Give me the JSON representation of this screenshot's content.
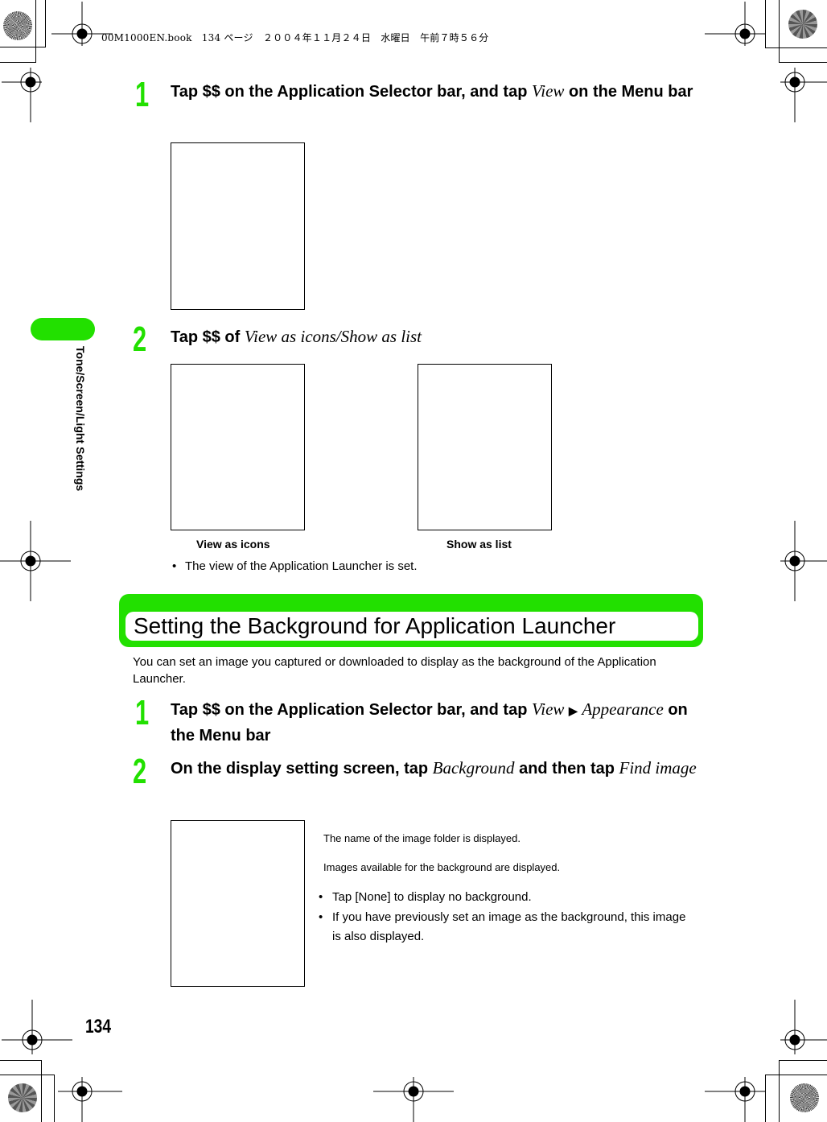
{
  "print_header": "00M1000EN.book　134 ページ　２００４年１１月２４日　水曜日　午前７時５６分",
  "side_tab": {
    "label": "Tone/Screen/Light Settings",
    "color": "#22e000"
  },
  "part1": {
    "steps": [
      {
        "number": "1",
        "text_before": "Tap $$ on the Application Selector bar, and tap ",
        "italic": "View",
        "text_after": " on the Menu bar"
      },
      {
        "number": "2",
        "text_before": "Tap $$ of ",
        "italic": "View as icons/Show as list",
        "text_after": ""
      }
    ],
    "captions": [
      "View as icons",
      "Show as list"
    ],
    "bullets": [
      "The view of the Application Launcher is set."
    ]
  },
  "section": {
    "title": "Setting the Background for Application Launcher",
    "intro": "You can set an image you captured or downloaded to display as the background of the Application Launcher."
  },
  "part2": {
    "steps": [
      {
        "number": "1",
        "text_before": "Tap $$ on the Application Selector bar, and tap ",
        "italic1": "View",
        "arrow": "▶",
        "italic2": "Appearance",
        "text_after": " on the Menu bar"
      },
      {
        "number": "2",
        "text_before": "On the display setting screen, tap ",
        "italic1": "Background",
        "text_mid": " and then tap ",
        "italic2": "Find image"
      }
    ],
    "notes": [
      "The name of the image folder is displayed.",
      "Images available for the background are displayed."
    ],
    "bullets": [
      "Tap [None] to display no background.",
      "If you have previously set an image as the background, this image is also displayed."
    ]
  },
  "page_number": "134",
  "bullet_glyph": "•"
}
